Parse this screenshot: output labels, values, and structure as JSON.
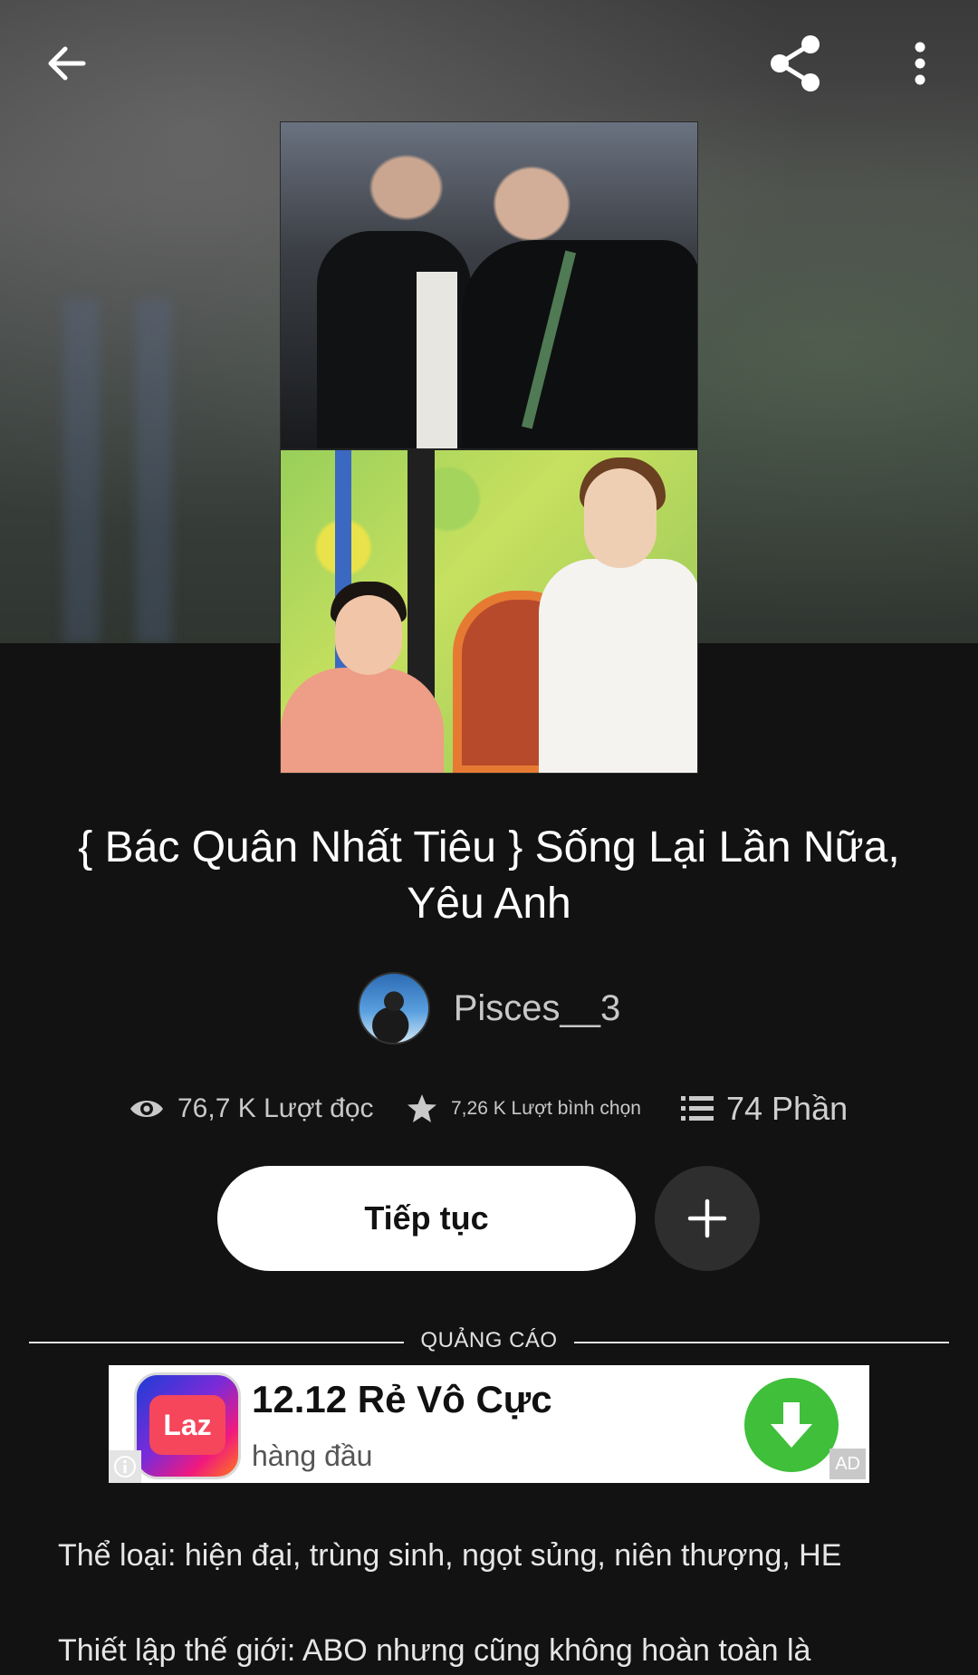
{
  "topbar": {
    "back_icon": "arrow-left-icon",
    "share_icon": "share-icon",
    "more_icon": "more-vertical-icon"
  },
  "story": {
    "title": "{ Bác Quân Nhất Tiêu } Sống Lại Lần Nữa, Yêu Anh",
    "author": "Pisces__3"
  },
  "stats": {
    "reads": "76,7 K Lượt đọc",
    "votes": "7,26 K Lượt bình chọn",
    "parts": "74 Phần"
  },
  "actions": {
    "continue_label": "Tiếp tục",
    "add_icon": "plus-icon"
  },
  "ad": {
    "section_label": "QUẢNG CÁO",
    "logo_text": "Laz",
    "title": "12.12 Rẻ Vô Cực",
    "subtitle": "hàng đầu",
    "badge": "AD",
    "download_icon": "download-arrow-icon",
    "info_icon": "info-icon"
  },
  "description": {
    "line1": "Thể loại: hiện đại, trùng sinh, ngọt sủng, niên thượng, HE",
    "line2": "Thiết lập thế giới: ABO nhưng cũng không hoàn toàn là"
  },
  "colors": {
    "background": "#121212",
    "primary_button": "#ffffff",
    "secondary_button": "#2e2e2e",
    "ad_download": "#3fbf3a"
  }
}
